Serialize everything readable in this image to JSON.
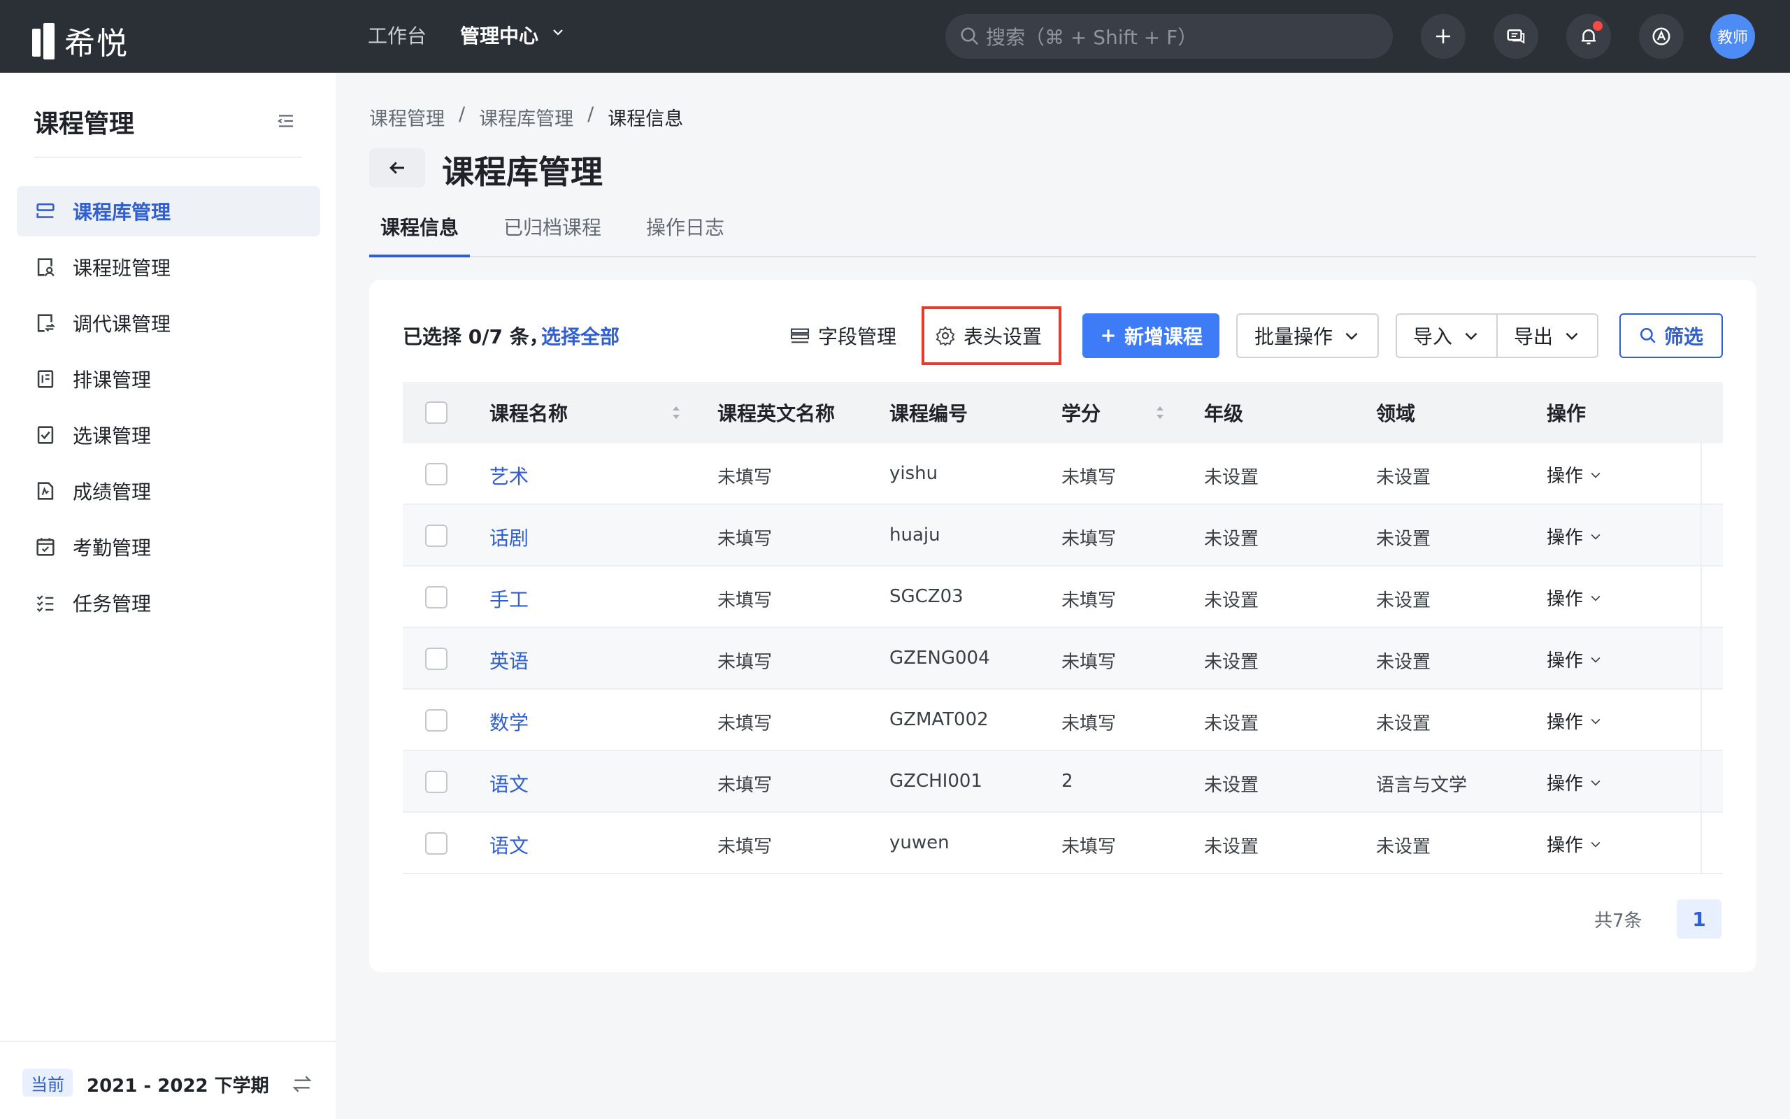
{
  "app": {
    "logo_text": "希悦"
  },
  "topnav": {
    "workbench": "工作台",
    "admin_center": "管理中心",
    "search_placeholder": "搜索（⌘ + Shift + F）",
    "avatar_text": "教师"
  },
  "sidebar": {
    "title": "课程管理",
    "items": [
      {
        "label": "课程库管理",
        "icon": "database-icon",
        "active": true
      },
      {
        "label": "课程班管理",
        "icon": "class-icon"
      },
      {
        "label": "调代课管理",
        "icon": "swap-icon"
      },
      {
        "label": "排课管理",
        "icon": "schedule-icon"
      },
      {
        "label": "选课管理",
        "icon": "check-icon"
      },
      {
        "label": "成绩管理",
        "icon": "score-icon"
      },
      {
        "label": "考勤管理",
        "icon": "calendar-icon"
      },
      {
        "label": "任务管理",
        "icon": "task-list-icon"
      }
    ],
    "term_badge": "当前",
    "term": "2021 - 2022 下学期"
  },
  "breadcrumb": [
    "课程管理",
    "课程库管理",
    "课程信息"
  ],
  "breadcrumb_sep": "/",
  "page_title": "课程库管理",
  "tabs": [
    "课程信息",
    "已归档课程",
    "操作日志"
  ],
  "toolbar": {
    "selected_prefix": "已选择 0/7 条，",
    "select_all": "选择全部",
    "field_manage": "字段管理",
    "header_settings": "表头设置",
    "add_course": "新增课程",
    "batch_ops": "批量操作",
    "import": "导入",
    "export": "导出",
    "filter": "筛选"
  },
  "table": {
    "headers": [
      "课程名称",
      "课程英文名称",
      "课程编号",
      "学分",
      "年级",
      "领域",
      "操作"
    ],
    "rows": [
      {
        "name": "艺术",
        "en": "未填写",
        "code": "yishu",
        "credit": "未填写",
        "grade": "未设置",
        "domain": "未设置",
        "op": "操作"
      },
      {
        "name": "话剧",
        "en": "未填写",
        "code": "huaju",
        "credit": "未填写",
        "grade": "未设置",
        "domain": "未设置",
        "op": "操作"
      },
      {
        "name": "手工",
        "en": "未填写",
        "code": "SGCZ03",
        "credit": "未填写",
        "grade": "未设置",
        "domain": "未设置",
        "op": "操作"
      },
      {
        "name": "英语",
        "en": "未填写",
        "code": "GZENG004",
        "credit": "未填写",
        "grade": "未设置",
        "domain": "未设置",
        "op": "操作"
      },
      {
        "name": "数学",
        "en": "未填写",
        "code": "GZMAT002",
        "credit": "未填写",
        "grade": "未设置",
        "domain": "未设置",
        "op": "操作"
      },
      {
        "name": "语文",
        "en": "未填写",
        "code": "GZCHI001",
        "credit": "2",
        "grade": "未设置",
        "domain": "语言与文学",
        "op": "操作"
      },
      {
        "name": "语文",
        "en": "未填写",
        "code": "yuwen",
        "credit": "未填写",
        "grade": "未设置",
        "domain": "未设置",
        "op": "操作"
      }
    ]
  },
  "pagination": {
    "total_text": "共7条",
    "current_page": "1"
  },
  "colors": {
    "accent": "#2f5fd0",
    "primary_button": "#3d7bf7",
    "topbar": "#2b2f36",
    "highlight": "#e53b2c"
  }
}
